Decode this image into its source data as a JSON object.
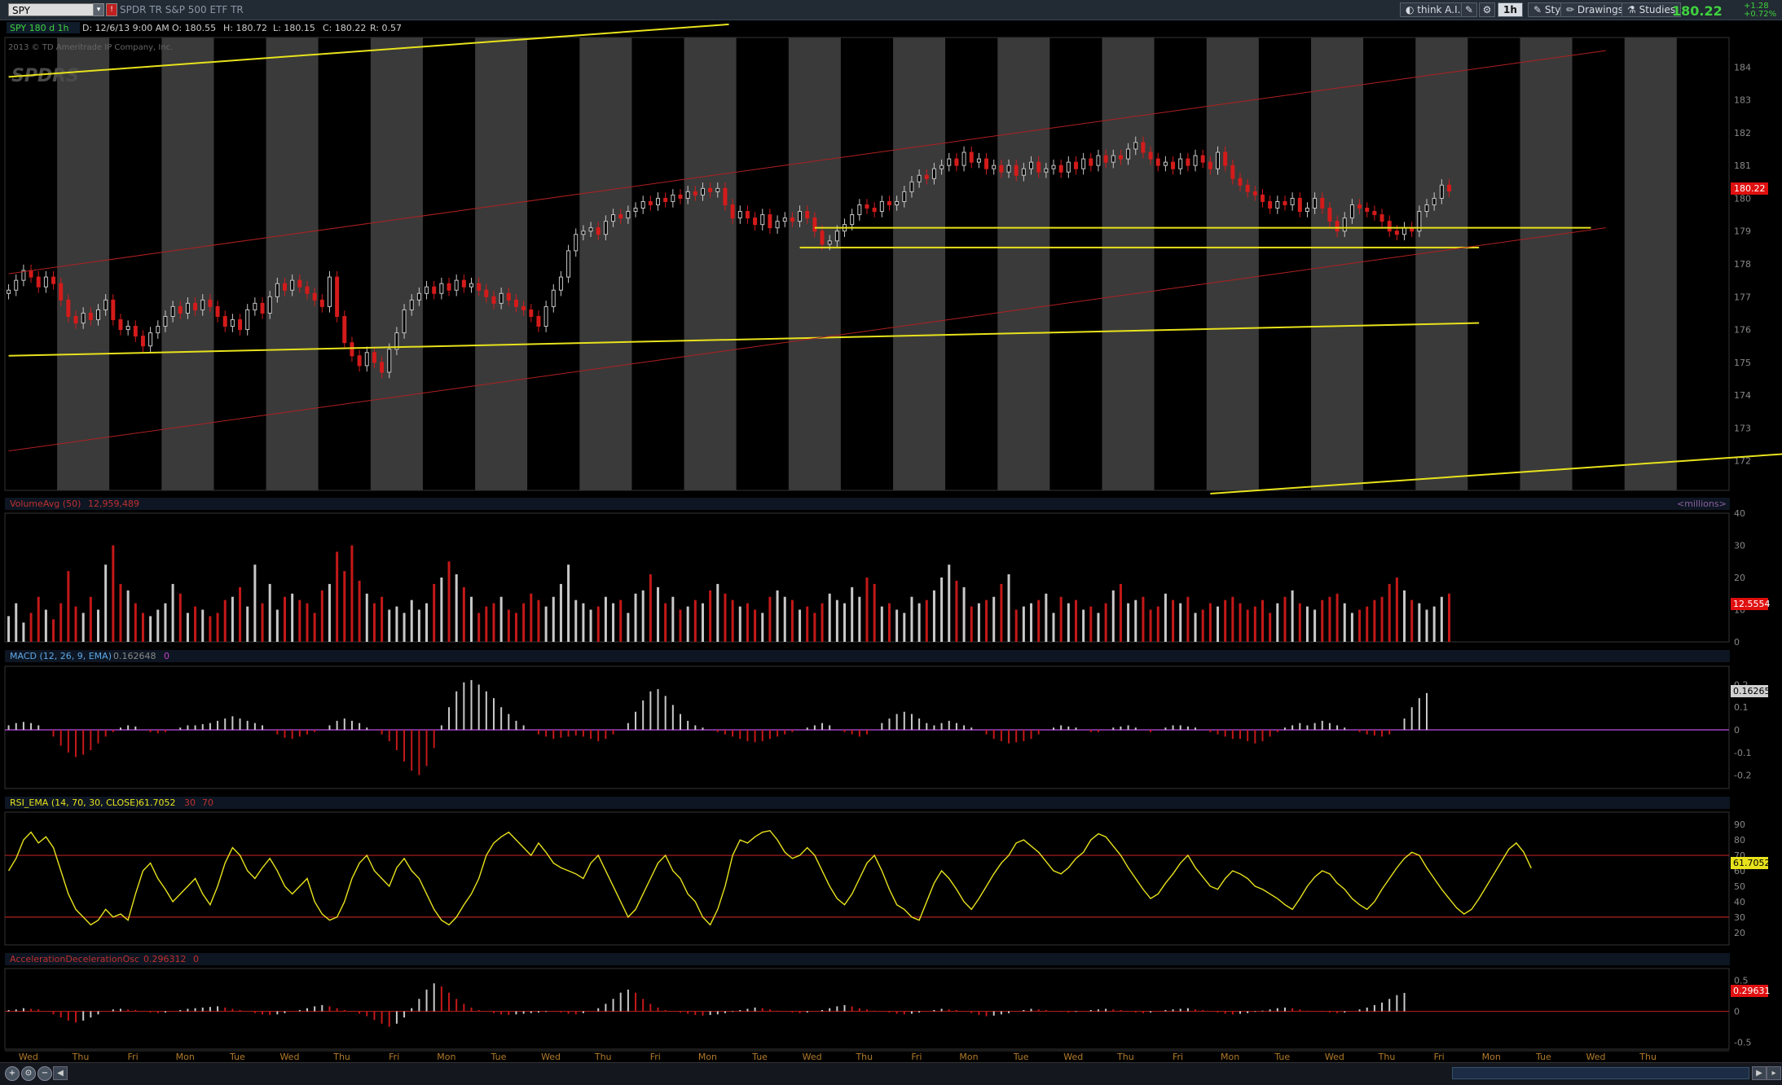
{
  "toolbar": {
    "symbol": "SPY",
    "description": "SPDR TR S&P 500 ETF TR",
    "think_label": "think A.I.",
    "timeframe_label": "1h",
    "style_label": "Style",
    "drawings_label": "Drawings",
    "studies_label": "Studies",
    "last_price": "180.22",
    "change_abs": "+1.28",
    "change_pct": "+0.72%"
  },
  "price_panel": {
    "header": {
      "title": "SPY 180 d 1h",
      "date": "D: 12/6/13 9:00 AM",
      "open": "O: 180.55",
      "high": "H: 180.72",
      "low": "L: 180.15",
      "close": "C: 180.22",
      "range": "R: 0.57"
    },
    "copyright": "2013 © TD Ameritrade IP Company, Inc.",
    "watermark": "SPDRS",
    "current_price_label": "180.22",
    "colors": {
      "up": "#c8c8c8",
      "down": "#d41b1b",
      "trendline": "#e8e21c",
      "channel": "#b02020"
    }
  },
  "volume_panel": {
    "title": "VolumeAvg (50)",
    "value": "12,959,489",
    "units": "<millions>",
    "current_label": "12.5554",
    "ticks": [
      "40",
      "30",
      "20",
      "10",
      "0"
    ]
  },
  "macd_panel": {
    "title": "MACD (12, 26, 9, EMA)",
    "value": "0.162648",
    "extra": "0",
    "current_label": "0.16265",
    "ticks": [
      "0.2",
      "0.1",
      "0",
      "-0.1",
      "-0.2"
    ]
  },
  "rsi_panel": {
    "title": "RSI_EMA (14, 70, 30, CLOSE)",
    "value": "61.7052",
    "os": "30",
    "ob": "70",
    "current_label": "61.7052",
    "ticks": [
      "90",
      "80",
      "70",
      "60",
      "50",
      "40",
      "30",
      "20"
    ]
  },
  "ac_panel": {
    "title": "AccelerationDecelerationOsc",
    "value": "0.296312",
    "extra": "0",
    "current_label": "0.29631",
    "ticks": [
      "0.5",
      "0",
      "-0.5"
    ]
  },
  "chart_data": {
    "type": "candlestick",
    "symbol": "SPY",
    "interval": "1h",
    "y_ticks": [
      "184",
      "183",
      "182",
      "181",
      "180",
      "179",
      "178",
      "177",
      "176",
      "175",
      "174",
      "173",
      "172"
    ],
    "ylim": [
      171.1,
      184.9
    ],
    "x_day_labels": [
      "Wed",
      "Thu",
      "Fri",
      "Mon",
      "Tue",
      "Wed",
      "Thu",
      "Fri",
      "Mon",
      "Tue",
      "Wed",
      "Thu",
      "Fri",
      "Mon",
      "Tue",
      "Wed",
      "Thu",
      "Fri",
      "Mon",
      "Tue",
      "Wed",
      "Thu",
      "Fri",
      "Mon",
      "Tue",
      "Wed",
      "Thu",
      "Fri",
      "Mon",
      "Tue",
      "Wed",
      "Thu"
    ],
    "sessions": [
      {
        "day": "Wed",
        "close": [
          177.2,
          177.5,
          177.8,
          177.6,
          177.3,
          177.6,
          177.4
        ]
      },
      {
        "day": "Thu",
        "close": [
          176.9,
          176.4,
          176.2,
          176.5,
          176.3,
          176.6,
          176.9
        ]
      },
      {
        "day": "Fri",
        "close": [
          176.3,
          176.0,
          176.1,
          175.8,
          175.5,
          175.9,
          176.1
        ]
      },
      {
        "day": "Mon",
        "close": [
          176.4,
          176.7,
          176.5,
          176.8,
          176.6,
          176.9,
          176.7
        ]
      },
      {
        "day": "Tue",
        "close": [
          176.4,
          176.1,
          176.3,
          176.0,
          176.6,
          176.8,
          176.5
        ]
      },
      {
        "day": "Wed",
        "close": [
          177.0,
          177.4,
          177.2,
          177.5,
          177.3,
          177.1,
          176.9
        ]
      },
      {
        "day": "Thu",
        "close": [
          176.7,
          177.6,
          176.4,
          175.6,
          175.2,
          174.9,
          175.3
        ]
      },
      {
        "day": "Fri",
        "close": [
          175.0,
          174.7,
          175.4,
          175.9,
          176.6,
          176.9,
          177.1
        ]
      },
      {
        "day": "Mon",
        "close": [
          177.3,
          177.1,
          177.4,
          177.2,
          177.5,
          177.3,
          177.4
        ]
      },
      {
        "day": "Tue",
        "close": [
          177.2,
          177.0,
          176.8,
          177.1,
          176.9,
          176.7,
          176.6
        ]
      },
      {
        "day": "Wed",
        "close": [
          176.4,
          176.1,
          176.7,
          177.2,
          177.6,
          178.4,
          178.9
        ]
      },
      {
        "day": "Thu",
        "close": [
          179.0,
          179.1,
          178.9,
          179.3,
          179.5,
          179.4,
          179.6
        ]
      },
      {
        "day": "Fri",
        "close": [
          179.7,
          179.9,
          179.8,
          180.0,
          179.9,
          180.1,
          180.0
        ]
      },
      {
        "day": "Mon",
        "close": [
          180.2,
          180.1,
          180.3,
          180.2,
          180.3,
          179.8,
          179.4
        ]
      },
      {
        "day": "Tue",
        "close": [
          179.6,
          179.4,
          179.2,
          179.5,
          179.1,
          179.3,
          179.4
        ]
      },
      {
        "day": "Wed",
        "close": [
          179.3,
          179.6,
          179.4,
          179.0,
          178.6,
          178.7,
          179.0
        ]
      },
      {
        "day": "Thu",
        "close": [
          179.2,
          179.5,
          179.8,
          179.7,
          179.6,
          179.9,
          179.8
        ]
      },
      {
        "day": "Fri",
        "close": [
          179.9,
          180.2,
          180.5,
          180.7,
          180.6,
          180.9,
          181.0
        ]
      },
      {
        "day": "Mon",
        "close": [
          181.2,
          181.0,
          181.4,
          181.1,
          181.2,
          180.9,
          181.0
        ]
      },
      {
        "day": "Tue",
        "close": [
          180.8,
          181.0,
          180.7,
          180.9,
          181.1,
          180.8,
          180.9
        ]
      },
      {
        "day": "Wed",
        "close": [
          181.0,
          180.8,
          181.1,
          180.9,
          181.2,
          181.0,
          181.3
        ]
      },
      {
        "day": "Thu",
        "close": [
          181.1,
          181.3,
          181.2,
          181.5,
          181.7,
          181.4,
          181.2
        ]
      },
      {
        "day": "Fri",
        "close": [
          181.0,
          181.1,
          180.9,
          181.2,
          181.0,
          181.3,
          181.1
        ]
      },
      {
        "day": "Mon",
        "close": [
          180.9,
          181.4,
          181.0,
          180.6,
          180.4,
          180.2,
          180.1
        ]
      },
      {
        "day": "Tue",
        "close": [
          179.9,
          179.7,
          179.9,
          179.8,
          180.0,
          179.6,
          179.7
        ]
      },
      {
        "day": "Wed",
        "close": [
          180.0,
          179.7,
          179.3,
          179.0,
          179.4,
          179.8,
          179.7
        ]
      },
      {
        "day": "Thu",
        "close": [
          179.6,
          179.5,
          179.3,
          179.0,
          178.9,
          179.1,
          179.0
        ]
      },
      {
        "day": "Fri",
        "close": [
          179.6,
          179.8,
          180.0,
          180.4,
          180.22
        ]
      }
    ],
    "trendlines": [
      {
        "color": "#e8e21c",
        "from": [
          0,
          183.7
        ],
        "to": [
          96.5,
          185.3
        ]
      },
      {
        "color": "#e8e21c",
        "from": [
          0,
          175.2
        ],
        "to": [
          197,
          176.2
        ]
      },
      {
        "color": "#e8e21c",
        "from": [
          161,
          171.0
        ],
        "to": [
          250,
          172.4
        ]
      },
      {
        "color": "#e8e21c",
        "from": [
          108,
          179.1
        ],
        "to": [
          212,
          179.1
        ]
      },
      {
        "color": "#e8e21c",
        "from": [
          106,
          178.5
        ],
        "to": [
          197,
          178.5
        ]
      },
      {
        "color": "#b02020",
        "from": [
          0,
          177.7
        ],
        "to": [
          214,
          184.5
        ]
      },
      {
        "color": "#b02020",
        "from": [
          0,
          172.3
        ],
        "to": [
          214,
          179.1
        ]
      }
    ],
    "volume_millions": [
      8,
      12,
      6,
      9,
      14,
      10,
      7,
      12,
      22,
      11,
      9,
      14,
      10,
      24,
      30,
      18,
      16,
      12,
      9,
      8,
      10,
      12,
      18,
      15,
      9,
      11,
      10,
      8,
      9,
      13,
      14,
      17,
      11,
      24,
      12,
      18,
      10,
      14,
      15,
      13,
      12,
      9,
      16,
      18,
      28,
      22,
      30,
      19,
      15,
      12,
      14,
      10,
      11,
      9,
      13,
      10,
      12,
      18,
      20,
      25,
      21,
      17,
      14,
      9,
      11,
      12,
      14,
      10,
      9,
      12,
      15,
      13,
      11,
      14,
      18,
      24,
      13,
      12,
      10,
      11,
      14,
      12,
      13,
      9,
      15,
      16,
      21,
      17,
      12,
      14,
      10,
      11,
      13,
      12,
      16,
      18,
      15,
      13,
      11,
      12,
      10,
      9,
      14,
      16,
      14,
      13,
      10,
      11,
      9,
      12,
      15,
      13,
      12,
      17,
      14,
      20,
      18,
      11,
      12,
      10,
      9,
      14,
      12,
      13,
      16,
      20,
      24,
      19,
      17,
      11,
      12,
      13,
      14,
      18,
      21,
      10,
      11,
      12,
      13,
      15,
      9,
      14,
      12,
      13,
      10,
      11,
      9,
      12,
      16,
      18,
      12,
      13,
      14,
      10,
      11,
      15,
      13,
      12,
      14,
      9,
      10,
      12,
      11,
      13,
      14,
      12,
      10,
      11,
      13,
      9,
      12,
      14,
      16,
      12,
      11,
      10,
      13,
      14,
      15,
      12,
      9,
      10,
      11,
      13,
      14,
      18,
      20,
      16,
      13,
      12,
      10,
      11,
      14,
      15,
      13,
      12,
      9,
      11,
      12,
      10,
      13,
      16,
      22,
      18,
      21,
      14,
      12,
      11,
      13,
      20,
      18,
      12,
      17,
      22,
      19,
      13
    ],
    "macd": [
      0.02,
      0.03,
      0.035,
      0.03,
      0.02,
      0.0,
      -0.03,
      -0.07,
      -0.1,
      -0.12,
      -0.11,
      -0.09,
      -0.06,
      -0.03,
      -0.01,
      0.01,
      0.02,
      0.015,
      0.0,
      -0.01,
      -0.015,
      -0.01,
      0.0,
      0.01,
      0.02,
      0.02,
      0.025,
      0.03,
      0.04,
      0.05,
      0.06,
      0.05,
      0.04,
      0.03,
      0.02,
      0.0,
      -0.02,
      -0.035,
      -0.04,
      -0.03,
      -0.02,
      -0.01,
      0.0,
      0.02,
      0.04,
      0.05,
      0.04,
      0.03,
      0.01,
      0.0,
      -0.02,
      -0.05,
      -0.09,
      -0.14,
      -0.18,
      -0.2,
      -0.16,
      -0.08,
      0.02,
      0.1,
      0.17,
      0.21,
      0.22,
      0.2,
      0.17,
      0.14,
      0.1,
      0.07,
      0.04,
      0.02,
      0.0,
      -0.02,
      -0.03,
      -0.04,
      -0.035,
      -0.03,
      -0.025,
      -0.03,
      -0.04,
      -0.05,
      -0.04,
      -0.02,
      0.0,
      0.03,
      0.08,
      0.13,
      0.17,
      0.18,
      0.15,
      0.11,
      0.07,
      0.04,
      0.02,
      0.01,
      0.0,
      -0.01,
      -0.02,
      -0.03,
      -0.04,
      -0.05,
      -0.055,
      -0.05,
      -0.04,
      -0.03,
      -0.02,
      -0.01,
      0.0,
      0.01,
      0.02,
      0.03,
      0.02,
      0.0,
      -0.01,
      -0.02,
      -0.03,
      -0.02,
      0.0,
      0.03,
      0.05,
      0.07,
      0.08,
      0.07,
      0.05,
      0.03,
      0.02,
      0.03,
      0.04,
      0.03,
      0.02,
      0.01,
      0.0,
      -0.02,
      -0.04,
      -0.05,
      -0.06,
      -0.055,
      -0.05,
      -0.04,
      -0.02,
      0.0,
      0.01,
      0.02,
      0.015,
      0.01,
      0.0,
      -0.01,
      -0.01,
      0.0,
      0.01,
      0.015,
      0.02,
      0.01,
      0.0,
      -0.01,
      0.0,
      0.01,
      0.02,
      0.02,
      0.015,
      0.01,
      0.0,
      -0.01,
      -0.02,
      -0.03,
      -0.04,
      -0.04,
      -0.05,
      -0.06,
      -0.05,
      -0.03,
      -0.01,
      0.01,
      0.02,
      0.03,
      0.02,
      0.03,
      0.04,
      0.03,
      0.02,
      0.01,
      0.0,
      -0.01,
      -0.02,
      -0.025,
      -0.03,
      -0.02,
      0.0,
      0.05,
      0.1,
      0.14,
      0.162648
    ],
    "rsi": [
      60,
      68,
      80,
      85,
      78,
      82,
      75,
      60,
      45,
      35,
      30,
      25,
      28,
      35,
      30,
      32,
      28,
      45,
      60,
      65,
      55,
      48,
      40,
      45,
      50,
      55,
      45,
      38,
      50,
      65,
      75,
      70,
      60,
      55,
      62,
      68,
      60,
      50,
      45,
      50,
      55,
      40,
      32,
      28,
      30,
      40,
      55,
      65,
      70,
      60,
      55,
      50,
      62,
      68,
      60,
      55,
      45,
      35,
      28,
      25,
      30,
      38,
      45,
      55,
      70,
      78,
      82,
      85,
      80,
      75,
      70,
      78,
      72,
      65,
      62,
      60,
      58,
      55,
      65,
      70,
      60,
      50,
      40,
      30,
      35,
      45,
      55,
      65,
      70,
      60,
      55,
      45,
      40,
      30,
      25,
      35,
      50,
      70,
      80,
      78,
      82,
      85,
      86,
      80,
      72,
      68,
      70,
      75,
      70,
      60,
      50,
      42,
      38,
      45,
      55,
      65,
      70,
      60,
      48,
      38,
      35,
      30,
      28,
      40,
      52,
      60,
      55,
      48,
      40,
      35,
      42,
      50,
      58,
      65,
      70,
      78,
      80,
      76,
      72,
      66,
      60,
      58,
      62,
      68,
      72,
      80,
      84,
      82,
      76,
      70,
      62,
      55,
      48,
      42,
      45,
      52,
      58,
      65,
      70,
      62,
      56,
      50,
      48,
      55,
      60,
      58,
      55,
      50,
      48,
      45,
      42,
      38,
      35,
      42,
      50,
      56,
      60,
      58,
      52,
      48,
      42,
      38,
      35,
      40,
      48,
      55,
      62,
      68,
      72,
      70,
      62,
      55,
      48,
      42,
      36,
      32,
      35,
      42,
      50,
      58,
      66,
      74,
      78,
      72,
      61.7052
    ],
    "ac": [
      0.02,
      0.03,
      0.05,
      0.04,
      0.03,
      0.0,
      -0.05,
      -0.1,
      -0.15,
      -0.18,
      -0.15,
      -0.1,
      -0.05,
      0.0,
      0.03,
      0.04,
      0.03,
      0.02,
      0.0,
      -0.02,
      -0.03,
      -0.02,
      0.0,
      0.02,
      0.04,
      0.05,
      0.06,
      0.07,
      0.08,
      0.06,
      0.04,
      0.02,
      0.0,
      -0.03,
      -0.05,
      -0.06,
      -0.05,
      -0.03,
      0.0,
      0.02,
      0.05,
      0.08,
      0.1,
      0.08,
      0.05,
      0.02,
      0.0,
      -0.04,
      -0.08,
      -0.14,
      -0.2,
      -0.25,
      -0.2,
      -0.1,
      0.05,
      0.2,
      0.35,
      0.45,
      0.4,
      0.3,
      0.2,
      0.12,
      0.06,
      0.02,
      0.0,
      -0.03,
      -0.05,
      -0.06,
      -0.05,
      -0.04,
      -0.03,
      -0.02,
      -0.01,
      0.0,
      -0.02,
      -0.04,
      -0.05,
      -0.03,
      0.0,
      0.05,
      0.12,
      0.2,
      0.3,
      0.35,
      0.3,
      0.2,
      0.12,
      0.06,
      0.02,
      0.0,
      -0.02,
      -0.04,
      -0.06,
      -0.07,
      -0.06,
      -0.05,
      -0.03,
      -0.01,
      0.02,
      0.04,
      0.06,
      0.05,
      0.03,
      0.01,
      0.0,
      -0.02,
      -0.03,
      -0.02,
      0.0,
      0.02,
      0.05,
      0.08,
      0.1,
      0.08,
      0.05,
      0.03,
      0.01,
      0.0,
      -0.02,
      -0.04,
      -0.05,
      -0.04,
      -0.02,
      0.0,
      0.02,
      0.04,
      0.03,
      0.02,
      0.0,
      -0.03,
      -0.06,
      -0.08,
      -0.07,
      -0.05,
      -0.03,
      0.0,
      0.02,
      0.04,
      0.03,
      0.02,
      0.0,
      -0.01,
      -0.02,
      -0.01,
      0.0,
      0.02,
      0.03,
      0.04,
      0.03,
      0.02,
      0.0,
      -0.02,
      -0.03,
      -0.02,
      0.0,
      0.02,
      0.03,
      0.04,
      0.05,
      0.03,
      0.02,
      0.0,
      -0.02,
      -0.04,
      -0.05,
      -0.04,
      -0.03,
      -0.01,
      0.01,
      0.03,
      0.05,
      0.06,
      0.05,
      0.03,
      0.01,
      0.0,
      -0.01,
      -0.02,
      -0.03,
      -0.02,
      0.0,
      0.03,
      0.06,
      0.1,
      0.14,
      0.2,
      0.26,
      0.296312
    ]
  }
}
